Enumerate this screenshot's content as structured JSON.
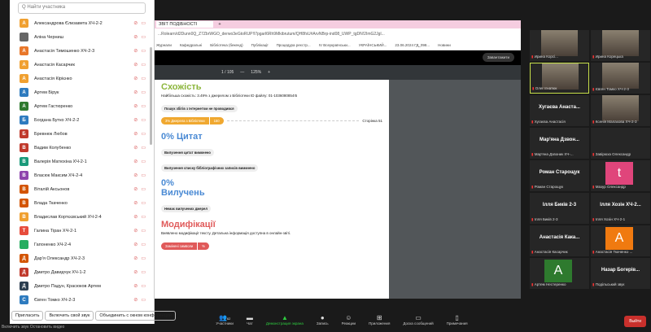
{
  "participants": {
    "search_placeholder": "Q Найти участника",
    "list": [
      {
        "initial": "А",
        "name": "Александрова Єлизавета ХЧ-2-2",
        "color": "#f0a030"
      },
      {
        "initial": "",
        "name": "Аліна Черниш",
        "color": "#666"
      },
      {
        "initial": "А",
        "name": "Анастасія Тимошенко ХЧ-2-3",
        "color": "#e8772a"
      },
      {
        "initial": "А",
        "name": "Анастасія Касарчик",
        "color": "#f0a030"
      },
      {
        "initial": "А",
        "name": "Анастасія Кірієнко",
        "color": "#f0a030"
      },
      {
        "initial": "А",
        "name": "Артем Бірук",
        "color": "#2e7bbf"
      },
      {
        "initial": "А",
        "name": "Артем Гастюренко",
        "color": "#2e7a2e"
      },
      {
        "initial": "Б",
        "name": "Богдана Бутко ХЧ-2-2",
        "color": "#2e7bbf"
      },
      {
        "initial": "Б",
        "name": "Бревнюк Любов",
        "color": "#c0392b"
      },
      {
        "initial": "В",
        "name": "Вадим Колубенко",
        "color": "#c0392b"
      },
      {
        "initial": "В",
        "name": "Валерія Матюхіна ХЧ-2-1",
        "color": "#1a9a7a"
      },
      {
        "initial": "В",
        "name": "Власюк Максим ХЧ-2-4",
        "color": "#8e44ad"
      },
      {
        "initial": "В",
        "name": "Віталій Аксьонов",
        "color": "#d35400"
      },
      {
        "initial": "В",
        "name": "Влада Ткаченко",
        "color": "#d35400"
      },
      {
        "initial": "В",
        "name": "Владислав Кортєєвський ХЧ-2-4",
        "color": "#f0a030"
      },
      {
        "initial": "Т",
        "name": "Галина Тіран ХЧ-2-1",
        "color": "#e74c3c"
      },
      {
        "initial": "",
        "name": "Гапоненко ХЧ-2-4",
        "color": "#27ae60"
      },
      {
        "initial": "Д",
        "name": "Дар'я Олександр ХЧ-2-3",
        "color": "#d35400"
      },
      {
        "initial": "Д",
        "name": "Дмитро Давидчук ХЧ-1-2",
        "color": "#c0392b"
      },
      {
        "initial": "Д",
        "name": "Дмитро Падун, Красюков Артем",
        "color": "#2c3e50"
      },
      {
        "initial": "С",
        "name": "Євген Томко ХЧ-2-3",
        "color": "#2e7bbf"
      }
    ],
    "buttons": [
      "Пригласить",
      "Включить свой звук",
      "Объединить с окном конференции"
    ],
    "status": "Включить звук   Остановить видео"
  },
  "browser": {
    "tab_title": "ЗВІТ ПОДІБНОСТІ",
    "address": "...Rolearn/d2Dunn0Q_Z7ZbrWGO_derwo3eGtoRUP!I7pgarl6Rh9Mkibrutum/QH8fsU#ArvNBrp-ind08_UWP_tgDN!2ImG2Jgl...",
    "bookmarks": [
      "Журнали",
      "Кафедральні",
      "Бібліотека (бекенд)",
      "Публікації",
      "Процедура реєстр...",
      "IV Всеукраїнськи...",
      "УКРАЇНСЬКИЙ...",
      "23.06.2024 ГД_098...",
      "Новини"
    ],
    "download_label": "Завантажити",
    "page_indicator": "1 / 105",
    "zoom": "125%"
  },
  "report": {
    "similarity_title": "Схожість",
    "similarity_text": "Найбільша схожість: 3.49% з джерелом з Бібліотеки ID файлу: 01-1036080854!5",
    "internet_chip": "Пошук збігів з Інтернетом не проводився",
    "library_pill": "3% Джерела з Бібліотеки",
    "library_count": "150",
    "page_label": "Сторінка 51",
    "citations_title": "0% Цитат",
    "cit_chip1": "Вилучення цитат вимкнено",
    "cit_chip2": "Вилучення списку бібліографічних записів вимкнено",
    "excl_pct": "0%",
    "excl_title": "Вилучень",
    "excl_chip": "Немає вилучених джерел",
    "mod_title": "Модифікації",
    "mod_text": "Виявлено модифікації тексту. Детальна інформація доступна в онлайн-звіті.",
    "mod_pill": "Замінені символи",
    "mod_count": "%",
    "colors": {
      "similarity": "#8cb63c",
      "library": "#f0a830",
      "citations": "#4a8ad4",
      "modifications": "#e05a5a"
    }
  },
  "gallery": [
    {
      "label": "Ирина Корсі...",
      "photo": true
    },
    {
      "label": "Ирина Корецька",
      "photo": true
    },
    {
      "label": "Олег Ігнатюк",
      "photo": true,
      "active": true
    },
    {
      "label": "Євген Томко ХЧ-2-3",
      "photo": true
    },
    {
      "label": "Хугаєва Анастасія",
      "big": "Хугаєва Анаста..."
    },
    {
      "label": "Ксенія Малахова ХЧ-2-3",
      "photo": true
    },
    {
      "label": "Мар'яна Дзвоник ХЧ-...",
      "big": "Мар'яна Дзвон..."
    },
    {
      "label": "Завірюха Олександр"
    },
    {
      "label": "Роман Старощук",
      "big": "Роман Старощук"
    },
    {
      "label": "Мазур Олександр",
      "square": "t",
      "color": "#e0457b"
    },
    {
      "label": "Ілля Биків 2-3",
      "big": "Ілля Биків 2-3"
    },
    {
      "label": "Ілля Хозін ХЧ-2-1",
      "big": "Ілля Хозін ХЧ-2..."
    },
    {
      "label": "Анастасія Касарчик",
      "big": "Анастасія Кака..."
    },
    {
      "label": "Анастасія Ткаченко ...",
      "square": "A",
      "color": "#f07a10"
    },
    {
      "label": "Артем Нестеренко",
      "square": "A",
      "color": "#2e7a2e"
    },
    {
      "label": "Подільський звук",
      "big": "Назар Богерів..."
    }
  ],
  "toolbar": {
    "items": [
      {
        "icon": "participants",
        "label": "Участники",
        "count": "62"
      },
      {
        "icon": "chat",
        "label": "Чат"
      },
      {
        "icon": "share-screen",
        "label": "Демонстрация экрана"
      },
      {
        "icon": "record",
        "label": "Запись"
      },
      {
        "icon": "reactions",
        "label": "Реакции"
      },
      {
        "icon": "apps",
        "label": "Приложения"
      },
      {
        "icon": "whiteboard",
        "label": "Доска сообщений"
      },
      {
        "icon": "notes",
        "label": "Примечания"
      }
    ],
    "leave": "Выйти"
  }
}
